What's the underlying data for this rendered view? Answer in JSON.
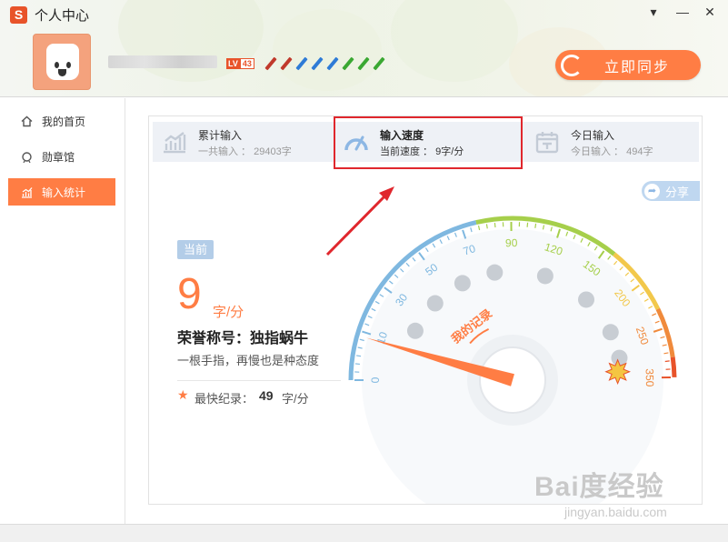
{
  "window": {
    "title": "个人中心",
    "logo_letter": "S",
    "menu_glyph": "▾",
    "minimize_glyph": "—",
    "close_glyph": "✕"
  },
  "profile": {
    "level_prefix": "LV",
    "level": "43",
    "pens": [
      "#c0392b",
      "#c0392b",
      "#2e7bd6",
      "#2e7bd6",
      "#2e7bd6",
      "#3aa832",
      "#3aa832",
      "#3aa832"
    ]
  },
  "sync_button": {
    "label": "立即同步"
  },
  "sidebar": {
    "items": [
      {
        "label": "我的首页",
        "icon": "home-icon",
        "active": false
      },
      {
        "label": "勋章馆",
        "icon": "medal-icon",
        "active": false
      },
      {
        "label": "输入统计",
        "icon": "stats-icon",
        "active": true
      }
    ]
  },
  "stats": [
    {
      "title": "累计输入",
      "value_label": "一共输入",
      "value": "29403字",
      "icon": "chart-icon",
      "active": false
    },
    {
      "title": "输入速度",
      "value_label": "当前速度",
      "value": "9字/分",
      "icon": "speedometer-icon",
      "active": true
    },
    {
      "title": "今日输入",
      "value_label": "今日输入",
      "value": "494字",
      "icon": "calendar-icon",
      "active": false
    }
  ],
  "share": {
    "label": "分享"
  },
  "current": {
    "badge": "当前",
    "speed": "9",
    "unit": "字/分",
    "honor": "荣誉称号：独指蜗牛",
    "description": "一根手指，再慢也是种态度",
    "best_label": "最快纪录：",
    "best_value": "49",
    "best_unit": "字/分"
  },
  "gauge": {
    "ticks": [
      "0",
      "10",
      "30",
      "50",
      "70",
      "90",
      "120",
      "150",
      "200",
      "250",
      "350"
    ],
    "record_label": "我的记录",
    "current_value": 9,
    "record_value": 49,
    "colors": {
      "blue": "#7fb8e0",
      "green": "#a6cf4b",
      "yellow": "#f2c84b",
      "orange": "#f08a3c",
      "red": "#e8532a",
      "needle": "#ff7d44"
    }
  },
  "watermark": {
    "brand": "Bai度经验",
    "url": "jingyan.baidu.com"
  }
}
